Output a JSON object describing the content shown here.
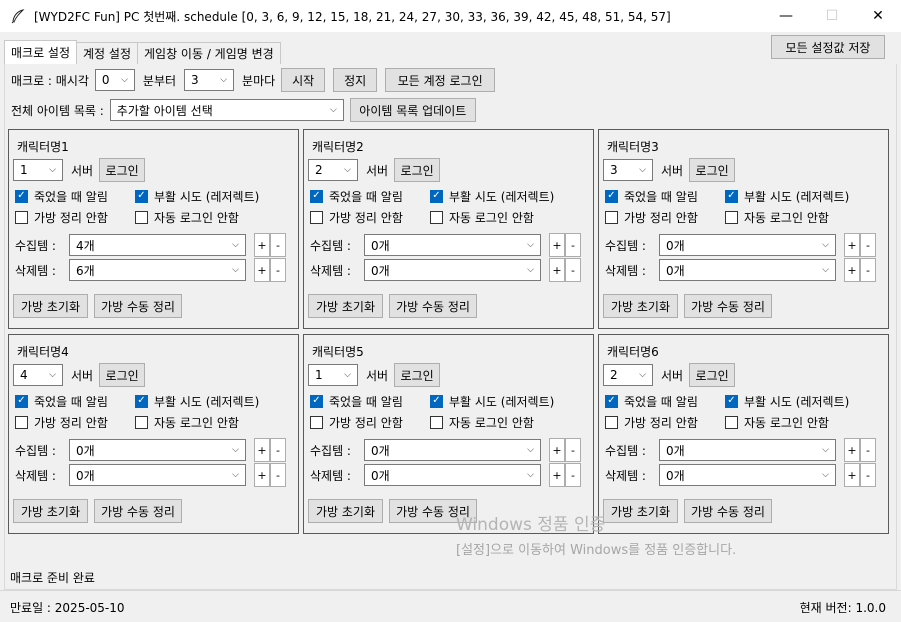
{
  "window": {
    "title": "[WYD2FC Fun] PC 첫번째. schedule [0, 3, 6, 9, 12, 15, 18, 21, 24, 27, 30, 33, 36, 39, 42, 45, 48, 51, 54, 57]",
    "app_icon": "feather-icon",
    "minimize": "—",
    "maximize": "☐",
    "close": "✕"
  },
  "tabs": [
    "매크로 설정",
    "계정 설정",
    "게임창 이동 / 게임명 변경"
  ],
  "save_all_label": "모든 설정값 저장",
  "macro_row": {
    "label_prefix": "매크로 : 매시각",
    "hour_value": "0",
    "label_from": "분부터",
    "interval_value": "3",
    "label_every": "분마다",
    "start_label": "시작",
    "stop_label": "정지",
    "login_all_label": "모든 계정 로그인"
  },
  "items_row": {
    "label": "전체 아이템 목록 :",
    "select_placeholder": "추가할 아이템 선택",
    "update_label": "아이템 목록 업데이트"
  },
  "common": {
    "server_label": "서버",
    "login_label": "로그인",
    "notify_death": "죽었을 때 알림",
    "revive_try": "부활 시도 (레저렉트)",
    "no_bag_sort": "가방 정리 안함",
    "no_auto_login": "자동 로그인 안함",
    "collect_label": "수집템 :",
    "delete_label": "삭제템 :",
    "plus": "+",
    "minus": "-",
    "bag_reset": "가방 초기화",
    "bag_manual_sort": "가방 수동 정리"
  },
  "characters": [
    {
      "name": "캐릭터명1",
      "server": "1",
      "collect": "4개",
      "delete": "6개",
      "notify_death": true,
      "revive": true,
      "no_bag_sort": false,
      "no_auto_login": false
    },
    {
      "name": "캐릭터명2",
      "server": "2",
      "collect": "0개",
      "delete": "0개",
      "notify_death": true,
      "revive": true,
      "no_bag_sort": false,
      "no_auto_login": false
    },
    {
      "name": "캐릭터명3",
      "server": "3",
      "collect": "0개",
      "delete": "0개",
      "notify_death": true,
      "revive": true,
      "no_bag_sort": false,
      "no_auto_login": false
    },
    {
      "name": "캐릭터명4",
      "server": "4",
      "collect": "0개",
      "delete": "0개",
      "notify_death": true,
      "revive": true,
      "no_bag_sort": false,
      "no_auto_login": false
    },
    {
      "name": "캐릭터명5",
      "server": "1",
      "collect": "0개",
      "delete": "0개",
      "notify_death": true,
      "revive": true,
      "no_bag_sort": false,
      "no_auto_login": false
    },
    {
      "name": "캐릭터명6",
      "server": "2",
      "collect": "0개",
      "delete": "0개",
      "notify_death": true,
      "revive": true,
      "no_bag_sort": false,
      "no_auto_login": false
    }
  ],
  "status": "매크로 준비 완료",
  "footer": {
    "expire": "만료일 : 2025-05-10",
    "version": "현재 버전: 1.0.0"
  },
  "watermark": {
    "line1": "Windows 정품 인증",
    "line2": "[설정]으로 이동하여 Windows를 정품 인증합니다."
  },
  "colors": {
    "checkbox_accent": "#0067c0",
    "window_bg": "#f0f0f0"
  }
}
